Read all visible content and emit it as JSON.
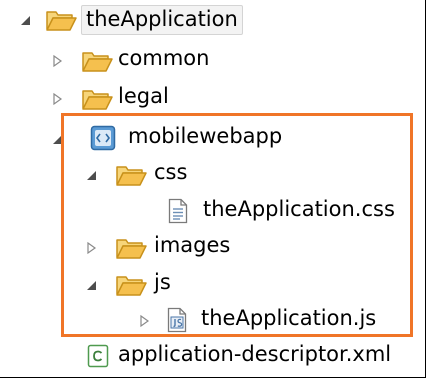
{
  "tree": {
    "root": {
      "label": "theApplication",
      "expanded": true,
      "icon": "folder-open-icon"
    },
    "items": [
      {
        "label": "common",
        "expanded": false,
        "icon": "folder-icon"
      },
      {
        "label": "legal",
        "expanded": false,
        "icon": "folder-icon"
      },
      {
        "label": "mobilewebapp",
        "expanded": true,
        "icon": "web-module-icon"
      },
      {
        "label": "css",
        "expanded": true,
        "icon": "folder-open-icon"
      },
      {
        "label": "theApplication.css",
        "icon": "css-file-icon"
      },
      {
        "label": "images",
        "expanded": false,
        "icon": "folder-icon"
      },
      {
        "label": "js",
        "expanded": true,
        "icon": "folder-open-icon"
      },
      {
        "label": "theApplication.js",
        "expanded": false,
        "icon": "js-file-icon"
      },
      {
        "label": "application-descriptor.xml",
        "icon": "xml-file-icon"
      }
    ]
  },
  "colors": {
    "highlight": "#f07527",
    "folder": "#f5c04e",
    "folder_outline": "#c8911b",
    "module": "#3b82c4"
  }
}
